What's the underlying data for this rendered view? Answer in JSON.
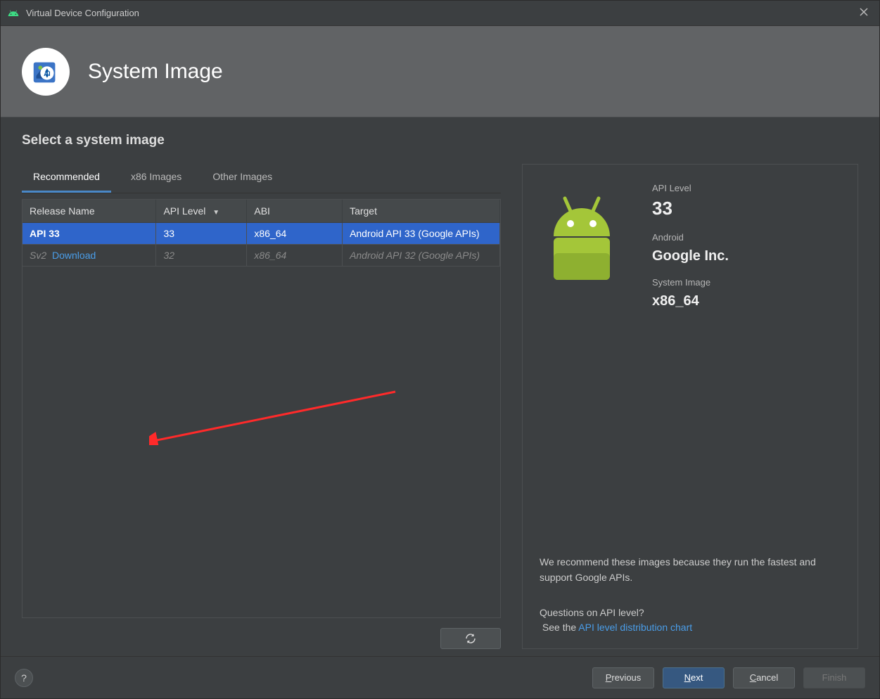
{
  "window": {
    "title": "Virtual Device Configuration"
  },
  "header": {
    "title": "System Image"
  },
  "section": {
    "title": "Select a system image"
  },
  "tabs": {
    "recommended": "Recommended",
    "x86": "x86 Images",
    "other": "Other Images"
  },
  "table": {
    "headers": {
      "release": "Release Name",
      "api": "API Level",
      "abi": "ABI",
      "target": "Target"
    },
    "rows": [
      {
        "release": "API 33",
        "api": "33",
        "abi": "x86_64",
        "target": "Android API 33 (Google APIs)",
        "selected": true
      },
      {
        "release": "Sv2",
        "download": "Download",
        "api": "32",
        "abi": "x86_64",
        "target": "Android API 32 (Google APIs)",
        "disabled": true
      }
    ]
  },
  "detail": {
    "api_label": "API Level",
    "api_value": "33",
    "android_label": "Android",
    "vendor_value": "Google Inc.",
    "sysimg_label": "System Image",
    "sysimg_value": "x86_64",
    "recommend_text": "We recommend these images because they run the fastest and support Google APIs.",
    "question_text": "Questions on API level?",
    "link_prefix": "See the ",
    "link_text": "API level distribution chart"
  },
  "footer": {
    "previous": "Previous",
    "next": "Next",
    "cancel": "Cancel",
    "finish": "Finish"
  }
}
